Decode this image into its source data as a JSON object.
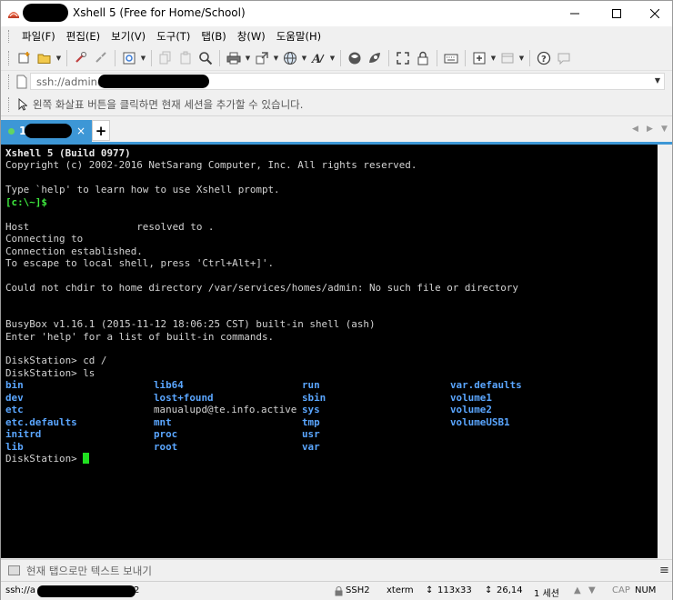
{
  "window": {
    "title": "Xshell 5 (Free for Home/School)"
  },
  "menu": [
    "파일(F)",
    "편집(E)",
    "보기(V)",
    "도구(T)",
    "탭(B)",
    "창(W)",
    "도움말(H)"
  ],
  "address": {
    "value": "ssh://admin@"
  },
  "hint": {
    "text": "왼쪽 화살표 버튼을 클릭하면 현재 세션을 추가할 수 있습니다."
  },
  "tabs": [
    {
      "label": "1",
      "close": "×"
    }
  ],
  "terminal": {
    "lines": [
      {
        "text": "Xshell 5 (Build 0977)",
        "style": "b"
      },
      {
        "text": "Copyright (c) 2002-2016 NetSarang Computer, Inc. All rights reserved.",
        "style": ""
      },
      {
        "text": "",
        "style": ""
      },
      {
        "text": "Type `help' to learn how to use Xshell prompt.",
        "style": ""
      },
      {
        "text": "[c:\\~]$",
        "style": "g"
      },
      {
        "text": "",
        "style": ""
      },
      {
        "text": "Host                  resolved to .",
        "style": ""
      },
      {
        "text": "Connecting to",
        "style": ""
      },
      {
        "text": "Connection established.",
        "style": ""
      },
      {
        "text": "To escape to local shell, press 'Ctrl+Alt+]'.",
        "style": ""
      },
      {
        "text": "",
        "style": ""
      },
      {
        "text": "Could not chdir to home directory /var/services/homes/admin: No such file or directory",
        "style": ""
      },
      {
        "text": "",
        "style": ""
      },
      {
        "text": "",
        "style": ""
      },
      {
        "text": "BusyBox v1.16.1 (2015-11-12 18:06:25 CST) built-in shell (ash)",
        "style": ""
      },
      {
        "text": "Enter 'help' for a list of built-in commands.",
        "style": ""
      },
      {
        "text": "",
        "style": ""
      },
      {
        "text": "DiskStation> cd /",
        "style": ""
      },
      {
        "text": "DiskStation> ls",
        "style": ""
      }
    ],
    "ls_entries": [
      {
        "name": "bin",
        "dir": true
      },
      {
        "name": "lib64",
        "dir": true
      },
      {
        "name": "run",
        "dir": true
      },
      {
        "name": "var.defaults",
        "dir": true
      },
      {
        "name": "dev",
        "dir": true
      },
      {
        "name": "lost+found",
        "dir": true
      },
      {
        "name": "sbin",
        "dir": true
      },
      {
        "name": "volume1",
        "dir": true
      },
      {
        "name": "etc",
        "dir": true
      },
      {
        "name": "manualupd@te.info.active",
        "dir": false
      },
      {
        "name": "sys",
        "dir": true
      },
      {
        "name": "volume2",
        "dir": true
      },
      {
        "name": "etc.defaults",
        "dir": true
      },
      {
        "name": "mnt",
        "dir": true
      },
      {
        "name": "tmp",
        "dir": true
      },
      {
        "name": "volumeUSB1",
        "dir": true
      },
      {
        "name": "initrd",
        "dir": true
      },
      {
        "name": "proc",
        "dir": true
      },
      {
        "name": "usr",
        "dir": true
      },
      {
        "name": "",
        "dir": true
      },
      {
        "name": "lib",
        "dir": true
      },
      {
        "name": "root",
        "dir": true
      },
      {
        "name": "var",
        "dir": true
      },
      {
        "name": "",
        "dir": true
      }
    ],
    "prompt": "DiskStation> "
  },
  "sendbar": {
    "text": "현재 탭으로만 텍스트 보내기"
  },
  "status": {
    "connection": "ssh://a",
    "connection_suffix": "2",
    "protocol": "SSH2",
    "term": "xterm",
    "size": "113x33",
    "cursor": "26,14",
    "sessions": "1 세션",
    "cap": "CAP",
    "num": "NUM"
  },
  "colors": {
    "accent": "#3d97d6",
    "terminal_bg": "#000000",
    "prompt_green": "#3ee83e",
    "dir_blue": "#5aa6ff"
  }
}
